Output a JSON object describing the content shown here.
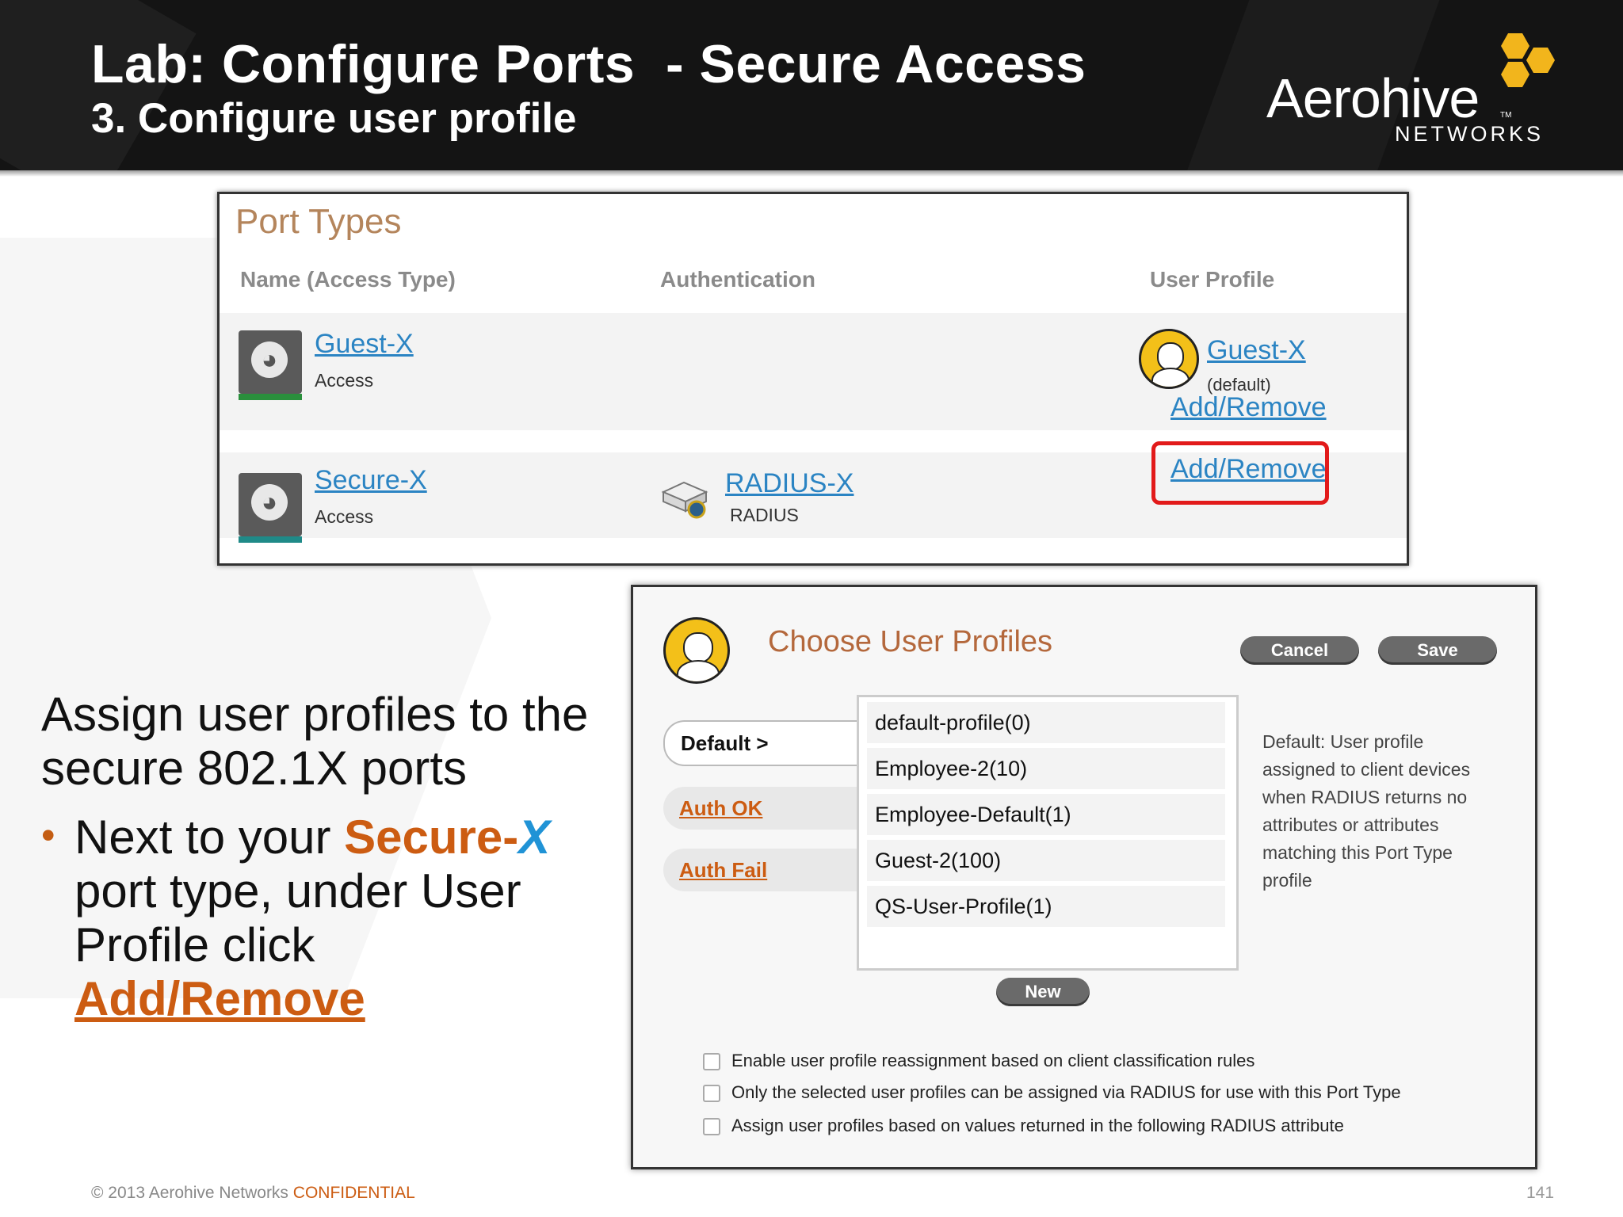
{
  "header": {
    "title": "Lab: Configure Ports  - Secure Access",
    "subtitle": "3. Configure user profile",
    "logo_main": "Aerohive",
    "logo_tm": "TM",
    "logo_sub": "NETWORKS"
  },
  "port_types": {
    "title": "Port Types",
    "columns": [
      "Name (Access Type)",
      "Authentication",
      "User Profile"
    ],
    "rows": [
      {
        "name": "Guest-X",
        "access": "Access",
        "auth_name": "",
        "auth_type": "",
        "profile": "Guest-X",
        "profile_note": "(default)",
        "action": "Add/Remove"
      },
      {
        "name": "Secure-X",
        "access": "Access",
        "auth_name": "RADIUS-X",
        "auth_type": "RADIUS",
        "profile": "",
        "profile_note": "",
        "action": "Add/Remove",
        "highlighted": true
      }
    ]
  },
  "instructions": {
    "lead": "Assign user profiles to the secure 802.1X ports",
    "bullet_prefix": "Next to your ",
    "bullet_secure": "Secure-",
    "bullet_x": "X",
    "bullet_middle": " port type, under User Profile click ",
    "bullet_link": "Add/Remove"
  },
  "dialog": {
    "title": "Choose User Profiles",
    "cancel_label": "Cancel",
    "save_label": "Save",
    "tabs": [
      "Default >",
      "Auth OK",
      "Auth Fail"
    ],
    "profiles": [
      "default-profile(0)",
      "Employee-2(10)",
      "Employee-Default(1)",
      "Guest-2(100)",
      "QS-User-Profile(1)"
    ],
    "description": "Default: User profile assigned to client devices when RADIUS returns no attributes or attributes matching this Port Type profile",
    "new_label": "New",
    "checkboxes": [
      {
        "label": "Enable user profile reassignment based on client classification rules",
        "checked": false
      },
      {
        "label": "Only the selected user profiles can be assigned via RADIUS for use with this Port Type",
        "checked": false
      },
      {
        "label": "Assign user profiles based on values returned in the following RADIUS attribute",
        "checked": false
      }
    ]
  },
  "footer": {
    "copyright": "© 2013 Aerohive Networks ",
    "confidential": "CONFIDENTIAL",
    "page": "141"
  },
  "colors": {
    "accent_orange": "#cc5c12",
    "link_blue": "#2b84c3",
    "highlight_red": "#e21a1a",
    "logo_yellow": "#f2b51c",
    "header_bg": "#141414"
  }
}
